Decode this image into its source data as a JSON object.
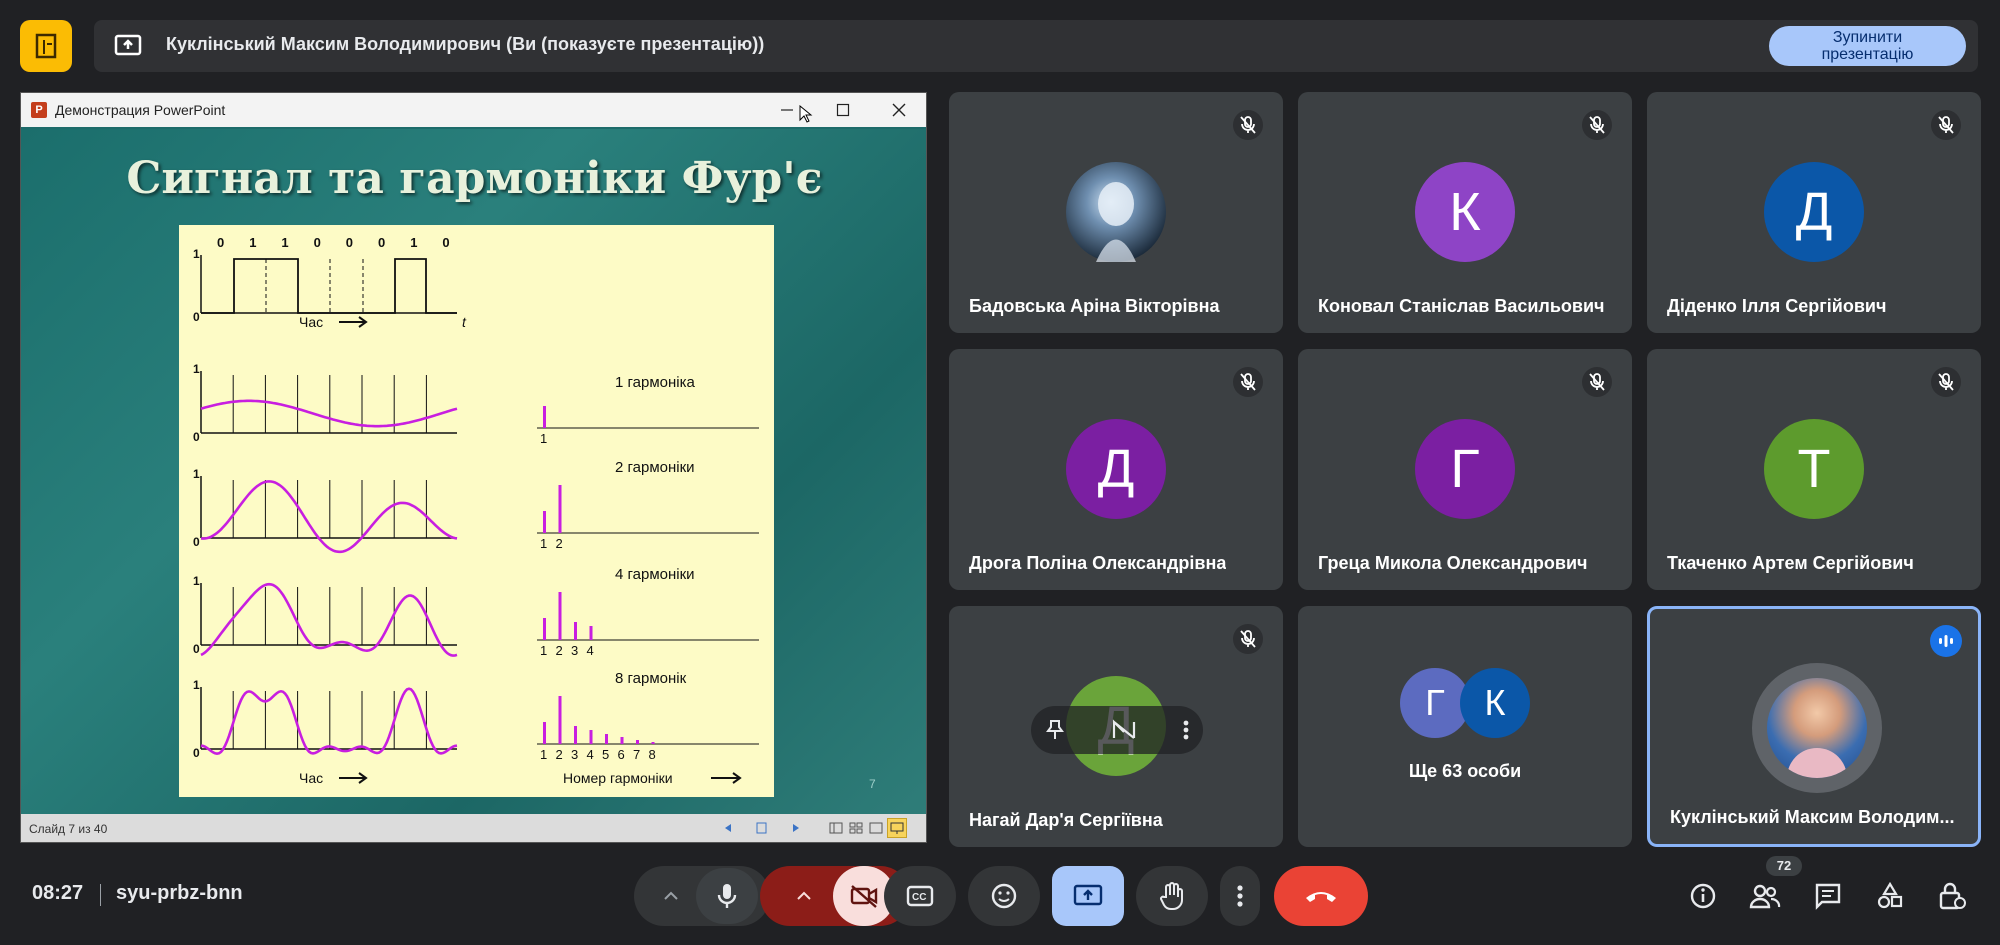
{
  "banner": {
    "presenting_text": "Куклінський Максим Володимирович (Ви (показуєте презентацію))",
    "stop_button": "Зупинити презентацію"
  },
  "ppt": {
    "window_title": "Демонстрация PowerPoint",
    "app_icon_letter": "P",
    "status": "Слайд 7 из 40",
    "slide_number": "7",
    "slide_title": "Сигнал та гармоніки Фур'є",
    "figure": {
      "bits": [
        "0",
        "1",
        "1",
        "0",
        "0",
        "0",
        "1",
        "0"
      ],
      "time_label": "Час",
      "t_label": "t",
      "y_one": "1",
      "y_zero": "0",
      "harmonic_labels": [
        "1 гармоніка",
        "2 гармоніки",
        "4 гармоніки",
        "8 гармонік"
      ],
      "harmonic_numbers": [
        "1",
        "2",
        "3",
        "4",
        "5",
        "6",
        "7",
        "8"
      ],
      "bottom_time_label": "Час",
      "harmonic_axis_label": "Номер гармоніки"
    }
  },
  "participants": [
    {
      "name": "Бадовська Аріна Вікторівна",
      "initial": "",
      "avatar_color": "#1b2a3a",
      "muted": true
    },
    {
      "name": "Коновал Станіслав Васильович",
      "initial": "К",
      "avatar_color": "#8e44c6",
      "muted": true
    },
    {
      "name": "Діденко Ілля Сергійович",
      "initial": "Д",
      "avatar_color": "#0b57a8",
      "muted": true
    },
    {
      "name": "Дрога Поліна Олександрівна",
      "initial": "Д",
      "avatar_color": "#7b1fa2",
      "muted": true
    },
    {
      "name": "Греца Микола Олександрович",
      "initial": "Г",
      "avatar_color": "#7b1fa2",
      "muted": true
    },
    {
      "name": "Ткаченко Артем Сергійович",
      "initial": "Т",
      "avatar_color": "#5d9b2d",
      "muted": true
    },
    {
      "name": "Нагай Дар'я Сергіївна",
      "initial": "Д",
      "avatar_color": "#6aa43a",
      "muted": true
    },
    {
      "name": "Ще 63 особи",
      "initials": [
        "Г",
        "К"
      ],
      "avatar_colors": [
        "#5c6bc0",
        "#0b57a8"
      ],
      "muted": false
    },
    {
      "name": "Куклінський Максим Володим...",
      "initial": "",
      "avatar_color": "#3b6db1",
      "speaking": true
    }
  ],
  "bottom": {
    "time": "08:27",
    "meeting_code": "syu-prbz-bnn",
    "people_count": "72"
  },
  "colors": {
    "end_call": "#ea4335",
    "present_active": "#a8c7fa",
    "camera_off": "#f9dedc",
    "camera_chevron": "#8c1d18",
    "accent": "#8ab4f8"
  }
}
